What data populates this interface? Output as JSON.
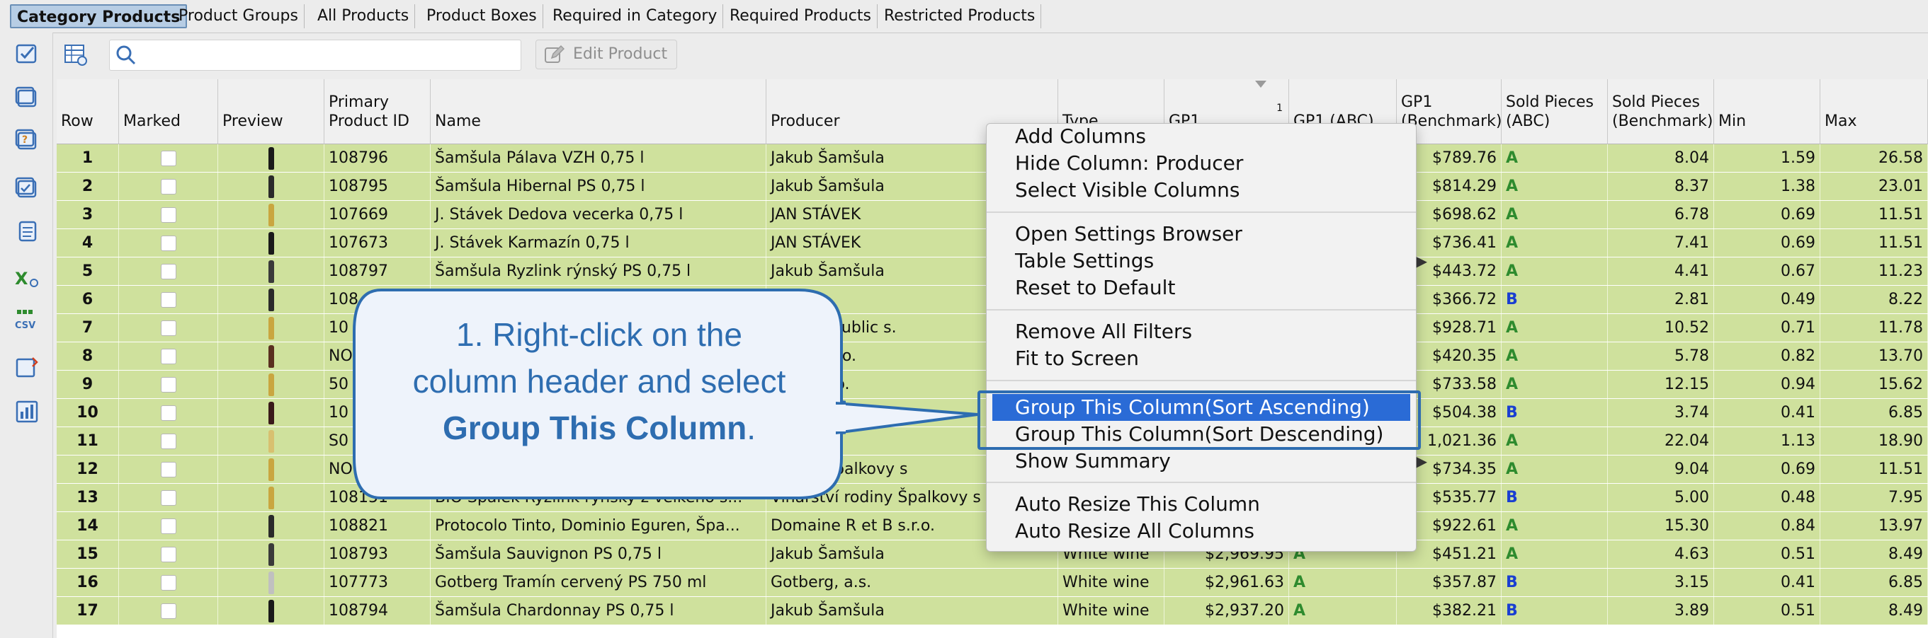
{
  "tabs": [
    {
      "label": "Category Products",
      "active": true
    },
    {
      "label": "Product Groups",
      "active": false
    },
    {
      "label": "All Products",
      "active": false
    },
    {
      "label": "Product Boxes",
      "active": false
    },
    {
      "label": "Required in Category",
      "active": false
    },
    {
      "label": "Required Products",
      "active": false
    },
    {
      "label": "Restricted Products",
      "active": false
    }
  ],
  "toolbar": {
    "search_placeholder": "",
    "edit_product_label": "Edit Product"
  },
  "rail_icons": [
    "check-list-icon",
    "window-icon",
    "help-doc-icon",
    "image-check-icon",
    "notes-icon",
    "excel-export-icon",
    "csv-export-icon",
    "sort-icon",
    "chart-icon"
  ],
  "table": {
    "columns": {
      "row": "Row",
      "marked": "Marked",
      "preview": "Preview",
      "primary_id_1": "Primary",
      "primary_id_2": "Product ID",
      "name": "Name",
      "producer": "Producer",
      "type": "Type",
      "gp1": "GP1",
      "gp1_sort_index": "1",
      "gp1_abc": "GP1 (ABC)",
      "gp1_bench_1": "GP1",
      "gp1_bench_2": "(Benchmark)",
      "sold_abc_1": "Sold Pieces",
      "sold_abc_2": "(ABC)",
      "sold_bench_1": "Sold Pieces",
      "sold_bench_2": "(Benchmark)",
      "min": "Min",
      "max": "Max"
    },
    "rows": [
      {
        "row": "1",
        "id": "108796",
        "name": "Šamšula Pálava VZH 0,75 l",
        "producer": "Jakub Šamšula",
        "type": "",
        "gp1": "",
        "gp1_abc": "",
        "bench": "$789.76",
        "sold_abc": "A",
        "sold_bench": "8.04",
        "min": "1.59",
        "max": "26.58"
      },
      {
        "row": "2",
        "id": "108795",
        "name": "Šamšula Hibernal PS 0,75 l",
        "producer": "Jakub Šamšula",
        "type": "",
        "gp1": "",
        "gp1_abc": "",
        "bench": "$814.29",
        "sold_abc": "A",
        "sold_bench": "8.37",
        "min": "1.38",
        "max": "23.01"
      },
      {
        "row": "3",
        "id": "107669",
        "name": "J. Stávek Dedova vecerka 0,75 l",
        "producer": "JAN STÁVEK",
        "type": "",
        "gp1": "",
        "gp1_abc": "",
        "bench": "$698.62",
        "sold_abc": "A",
        "sold_bench": "6.78",
        "min": "0.69",
        "max": "11.51"
      },
      {
        "row": "4",
        "id": "107673",
        "name": "J. Stávek Karmazín 0,75 l",
        "producer": "JAN STÁVEK",
        "type": "",
        "gp1": "",
        "gp1_abc": "",
        "bench": "$736.41",
        "sold_abc": "A",
        "sold_bench": "7.41",
        "min": "0.69",
        "max": "11.51"
      },
      {
        "row": "5",
        "id": "108797",
        "name": "Šamšula Ryzlink rýnský PS 0,75 l",
        "producer": "Jakub Šamšula",
        "type": "",
        "gp1": "",
        "gp1_abc": "",
        "bench": "$443.72",
        "sold_abc": "A",
        "sold_bench": "4.41",
        "min": "0.67",
        "max": "11.23"
      },
      {
        "row": "6",
        "id": "108",
        "name": "",
        "producer": "šula",
        "type": "",
        "gp1": "",
        "gp1_abc": "",
        "bench": "$366.72",
        "sold_abc": "B",
        "sold_bench": "2.81",
        "min": "0.49",
        "max": "8.22"
      },
      {
        "row": "7",
        "id": "10",
        "name": "",
        "producer": "zech Republic s.",
        "type": "",
        "gp1": "",
        "gp1_abc": "",
        "bench": "$928.71",
        "sold_abc": "A",
        "sold_bench": "10.52",
        "min": "0.71",
        "max": "11.78"
      },
      {
        "row": "8",
        "id": "NO",
        "name": "",
        "producer": "G CZ, s.r.o.",
        "type": "",
        "gp1": "",
        "gp1_abc": "",
        "bench": "$420.35",
        "sold_abc": "A",
        "sold_bench": "5.78",
        "min": "0.82",
        "max": "13.70"
      },
      {
        "row": "9",
        "id": "50",
        "name": "",
        "producer": "spol. s r.o.",
        "type": "",
        "gp1": "",
        "gp1_abc": "",
        "bench": "$733.58",
        "sold_abc": "A",
        "sold_bench": "12.15",
        "min": "0.94",
        "max": "15.62"
      },
      {
        "row": "10",
        "id": "10",
        "name": "",
        "producer": "",
        "type": "",
        "gp1": "",
        "gp1_abc": "",
        "bench": "$504.38",
        "sold_abc": "B",
        "sold_bench": "3.74",
        "min": "0.41",
        "max": "6.85"
      },
      {
        "row": "11",
        "id": "S0",
        "name": "",
        "producer": "r.o.",
        "type": "",
        "gp1": "",
        "gp1_abc": "",
        "bench": "1,021.36",
        "sold_abc": "A",
        "sold_bench": "22.04",
        "min": "1.13",
        "max": "18.90"
      },
      {
        "row": "12",
        "id": "NO",
        "name": "",
        "producer": "rodiny Špalkovy s",
        "type": "",
        "gp1": "",
        "gp1_abc": "",
        "bench": "$734.35",
        "sold_abc": "A",
        "sold_bench": "9.04",
        "min": "0.69",
        "max": "11.51"
      },
      {
        "row": "13",
        "id": "108151",
        "name": "BIO Špalek Ryzlink rýnský z velkého s...",
        "producer": "Vinařství rodiny Špalkovy s",
        "type": "",
        "gp1": "",
        "gp1_abc": "",
        "bench": "$535.77",
        "sold_abc": "B",
        "sold_bench": "5.00",
        "min": "0.48",
        "max": "7.95"
      },
      {
        "row": "14",
        "id": "108821",
        "name": "Protocolo Tinto, Dominio Eguren, Špa...",
        "producer": "Domaine R et B s.r.o.",
        "type": "",
        "gp1": "",
        "gp1_abc": "",
        "bench": "$922.61",
        "sold_abc": "A",
        "sold_bench": "15.30",
        "min": "0.84",
        "max": "13.97"
      },
      {
        "row": "15",
        "id": "108793",
        "name": "Šamšula Sauvignon PS 0,75 l",
        "producer": "Jakub Šamšula",
        "type": "White wine",
        "gp1": "$2,969.95",
        "gp1_abc": "A",
        "bench": "$451.21",
        "sold_abc": "A",
        "sold_bench": "4.63",
        "min": "0.51",
        "max": "8.49"
      },
      {
        "row": "16",
        "id": "107773",
        "name": "Gotberg Tramín cervený PS 750 ml",
        "producer": "Gotberg, a.s.",
        "type": "White wine",
        "gp1": "$2,961.63",
        "gp1_abc": "A",
        "bench": "$357.87",
        "sold_abc": "B",
        "sold_bench": "3.15",
        "min": "0.41",
        "max": "6.85"
      },
      {
        "row": "17",
        "id": "108794",
        "name": "Šamšula Chardonnay PS 0,75 l",
        "producer": "Jakub Šamšula",
        "type": "White wine",
        "gp1": "$2,937.20",
        "gp1_abc": "A",
        "bench": "$382.21",
        "sold_abc": "B",
        "sold_bench": "3.89",
        "min": "0.51",
        "max": "8.49"
      }
    ]
  },
  "context_menu": {
    "items": [
      {
        "label": "Add Columns"
      },
      {
        "label": "Hide Column: Producer"
      },
      {
        "label": "Select Visible Columns"
      },
      {
        "label": "Open Settings Browser"
      },
      {
        "label": "Table Settings"
      },
      {
        "label": "Reset to Default"
      },
      {
        "label": "Remove All Filters"
      },
      {
        "label": "Fit to Screen"
      },
      {
        "label": "Group This Column(Sort Ascending)"
      },
      {
        "label": "Group This Column(Sort Descending)"
      },
      {
        "label": "Show Summary"
      },
      {
        "label": "Auto Resize This Column"
      },
      {
        "label": "Auto Resize All Columns"
      }
    ],
    "highlighted_index": 8
  },
  "callout": {
    "line1": "1. Right-click on the",
    "line2": "column header and select",
    "line3_bold": "Group This Column",
    "line3_end": "."
  },
  "colors": {
    "row_bg": "#cfe19d",
    "menu_highlight": "#2a6bd6",
    "callout_border": "#2e6db0",
    "callout_fill": "#eef3fb",
    "callout_text": "#2e6db0",
    "abc_a": "#2e8b2e",
    "abc_b": "#1a3fd1"
  }
}
